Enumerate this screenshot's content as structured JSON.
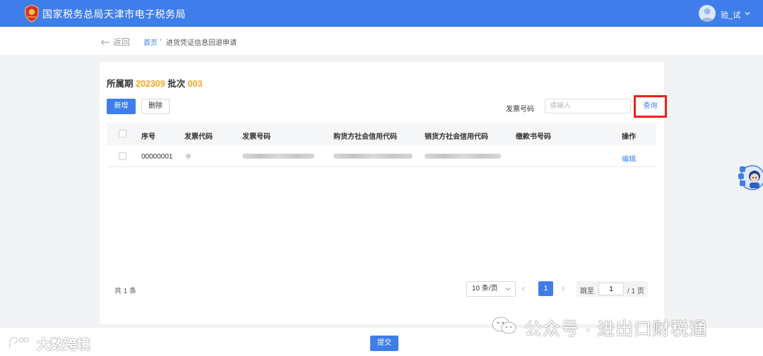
{
  "header": {
    "site_title": "国家税务总局天津市电子税务局",
    "user_name": "验_试",
    "brand_color": "#3f7eea"
  },
  "nav": {
    "back_label": "返回",
    "breadcrumb_home": "首页",
    "breadcrumb_separator": "›",
    "breadcrumb_current": "进货凭证信息回退申请"
  },
  "period": {
    "label": "所属期",
    "value": "202309",
    "batch_label": "批次",
    "batch_value": "003",
    "highlight_color": "#f5a623"
  },
  "toolbar": {
    "add_label": "新增",
    "delete_label": "删除",
    "search_label": "发票号码",
    "search_placeholder": "请输入",
    "query_label": "查询"
  },
  "table": {
    "columns": [
      "序号",
      "发票代码",
      "发票号码",
      "购货方社会信用代码",
      "销货方社会信用代码",
      "缴款书号码",
      "操作"
    ],
    "rows": [
      {
        "seq": "00000001",
        "action": "编辑"
      }
    ]
  },
  "pagination": {
    "total": "共 1 条",
    "page_size": "10 条/页",
    "current_page": "1",
    "jump_label": "跳至",
    "jump_value": "1",
    "total_pages": "/ 1 页"
  },
  "footer": {
    "submit_label": "提交"
  },
  "watermarks": {
    "left": "大数跨境",
    "right": "公众号 · 进出口财税通"
  },
  "icons": [
    "emblem-icon",
    "user-avatar-icon",
    "chevron-down-icon",
    "back-arrow-icon",
    "chevron-left-icon",
    "chevron-right-icon",
    "helper-robot-icon",
    "wechat-icon"
  ]
}
